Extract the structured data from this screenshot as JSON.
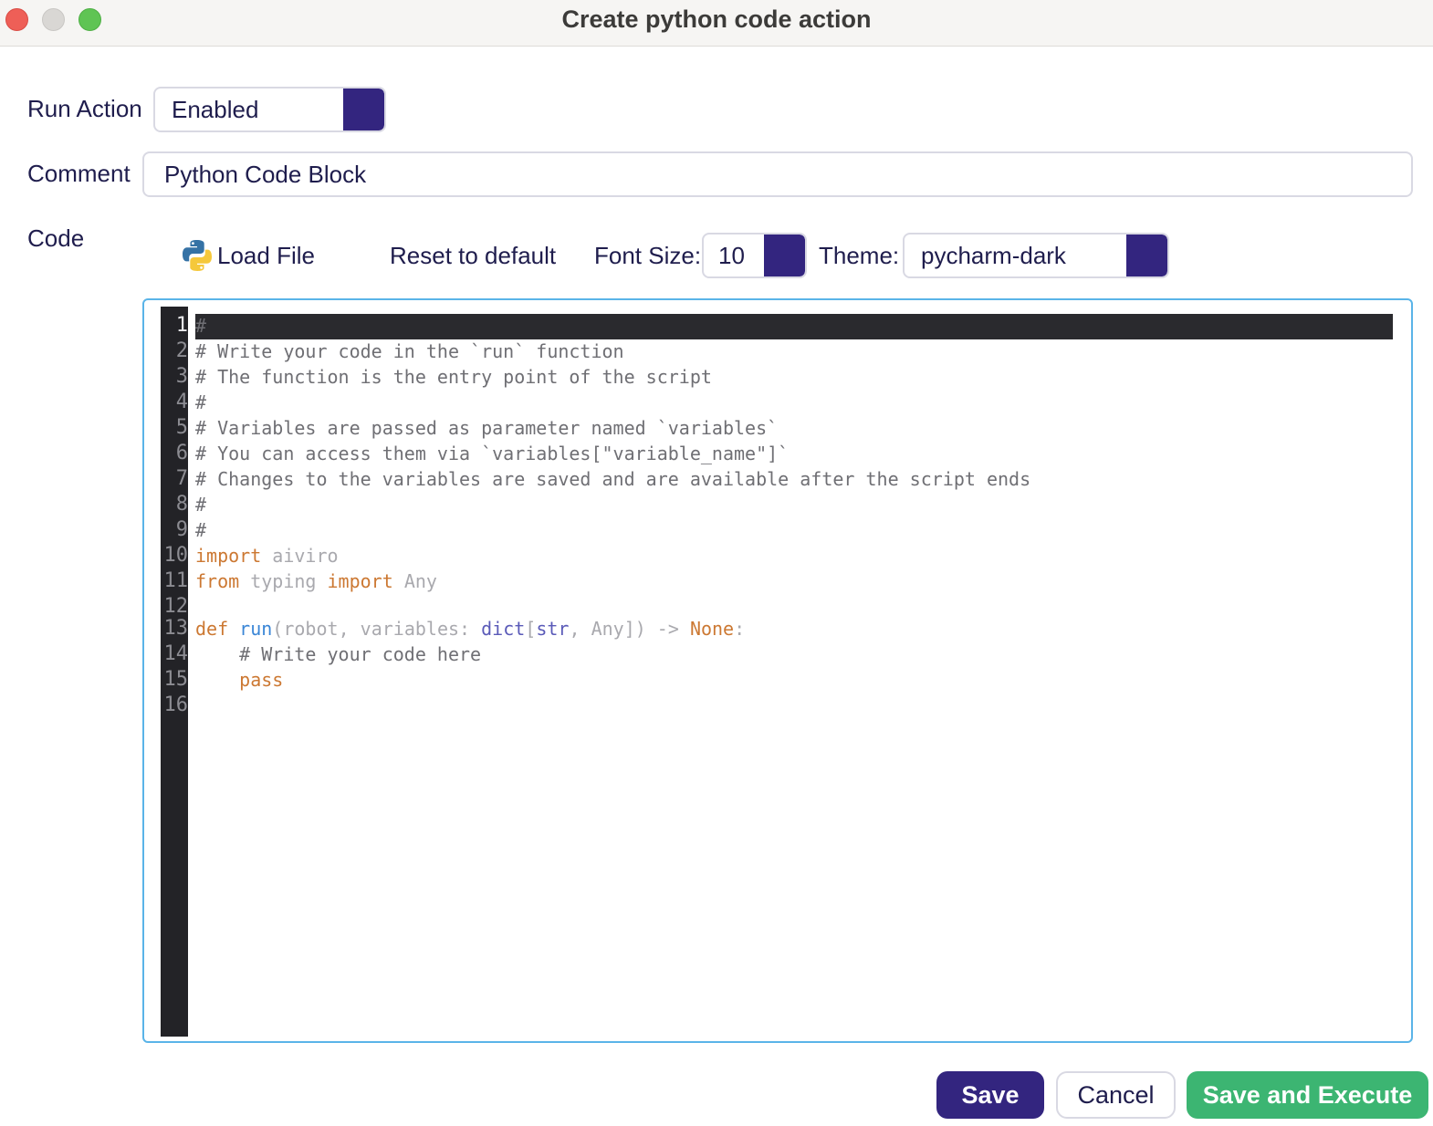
{
  "window": {
    "title": "Create python code action"
  },
  "form": {
    "run_action": {
      "label": "Run Action",
      "value": "Enabled"
    },
    "comment": {
      "label": "Comment",
      "value": "Python Code Block"
    },
    "code": {
      "label": "Code"
    }
  },
  "toolbar": {
    "load_file_label": "Load File",
    "load_file_icon": "python-icon",
    "reset_label": "Reset to default",
    "font_size_label": "Font Size:",
    "font_size_value": "10",
    "theme_label": "Theme:",
    "theme_value": "pycharm-dark"
  },
  "editor": {
    "active_line": 1,
    "line_numbers": [
      "1",
      "2",
      "3",
      "4",
      "5",
      "6",
      "7",
      "8",
      "9",
      "10",
      "11",
      "12",
      "13",
      "14",
      "15",
      "16"
    ],
    "lines": [
      "#",
      "# Write your code in the `run` function",
      "# The function is the entry point of the script",
      "#",
      "# Variables are passed as parameter named `variables`",
      "# You can access them via `variables[\"variable_name\"]`",
      "# Changes to the variables are saved and are available after the script ends",
      "#",
      "#",
      "import aiviro",
      "from typing import Any",
      "",
      "def run(robot, variables: dict[str, Any]) -> None:",
      "    # Write your code here",
      "    pass",
      ""
    ]
  },
  "footer": {
    "save_label": "Save",
    "cancel_label": "Cancel",
    "save_execute_label": "Save and Execute"
  },
  "colors": {
    "accent": "#33257f",
    "success": "#3cb572",
    "editor_border": "#5ab4e8",
    "gutter": "#232327"
  }
}
